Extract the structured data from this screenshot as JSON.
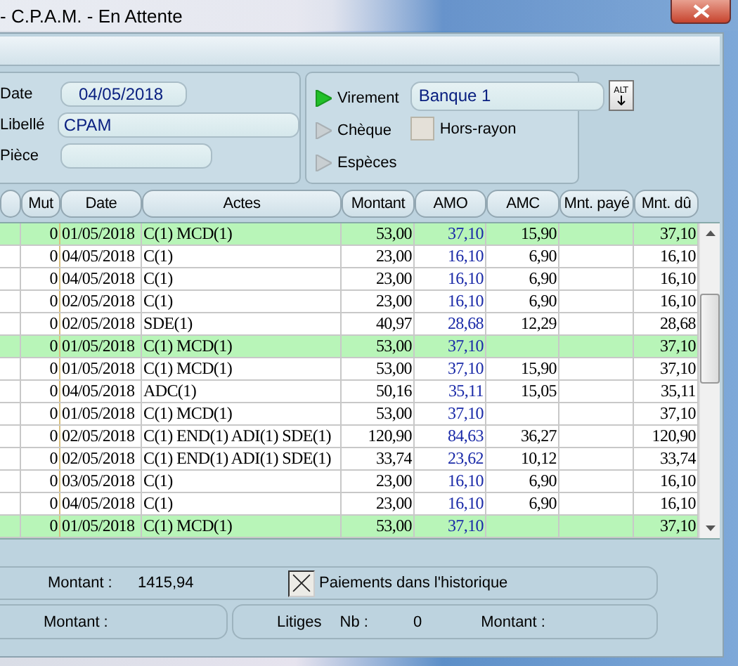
{
  "window": {
    "title": "- C.P.A.M. - En Attente"
  },
  "form": {
    "fields": [
      {
        "label": "Date",
        "value": "04/05/2018",
        "kind": "short"
      },
      {
        "label": "Libellé",
        "value": "CPAM",
        "kind": "long"
      },
      {
        "label": "Pièce",
        "kind": "medium"
      }
    ],
    "payment_modes": [
      {
        "label": "Virement",
        "selected": true
      },
      {
        "label": "Chèque",
        "selected": false
      },
      {
        "label": "Espèces",
        "selected": false
      }
    ],
    "bank": {
      "value": "Banque 1",
      "button": "ALT"
    },
    "hors_rayon": {
      "label": "Hors-rayon",
      "checked": false
    }
  },
  "table": {
    "columns": [
      "",
      "Mut",
      "Date",
      "Actes",
      "Montant",
      "AMO",
      "AMC",
      "Mnt. payé",
      "Mnt. dû"
    ],
    "rows": [
      {
        "highlighted": true,
        "cells": [
          "",
          "0",
          "01/05/2018",
          "C(1) MCD(1)",
          "53,00",
          "37,10",
          "15,90",
          "",
          "37,10"
        ]
      },
      {
        "highlighted": false,
        "cells": [
          "",
          "0",
          "04/05/2018",
          "C(1)",
          "23,00",
          "16,10",
          "6,90",
          "",
          "16,10"
        ]
      },
      {
        "highlighted": false,
        "cells": [
          "",
          "0",
          "04/05/2018",
          "C(1)",
          "23,00",
          "16,10",
          "6,90",
          "",
          "16,10"
        ]
      },
      {
        "highlighted": false,
        "cells": [
          "",
          "0",
          "02/05/2018",
          "C(1)",
          "23,00",
          "16,10",
          "6,90",
          "",
          "16,10"
        ]
      },
      {
        "highlighted": false,
        "cells": [
          "",
          "0",
          "02/05/2018",
          "SDE(1)",
          "40,97",
          "28,68",
          "12,29",
          "",
          "28,68"
        ]
      },
      {
        "highlighted": true,
        "cells": [
          "",
          "0",
          "01/05/2018",
          "C(1) MCD(1)",
          "53,00",
          "37,10",
          "",
          "",
          "37,10"
        ]
      },
      {
        "highlighted": false,
        "cells": [
          "",
          "0",
          "01/05/2018",
          "C(1) MCD(1)",
          "53,00",
          "37,10",
          "15,90",
          "",
          "37,10"
        ]
      },
      {
        "highlighted": false,
        "cells": [
          "",
          "0",
          "04/05/2018",
          "ADC(1)",
          "50,16",
          "35,11",
          "15,05",
          "",
          "35,11"
        ]
      },
      {
        "highlighted": false,
        "cells": [
          "",
          "0",
          "01/05/2018",
          "C(1) MCD(1)",
          "53,00",
          "37,10",
          "",
          "",
          "37,10"
        ]
      },
      {
        "highlighted": false,
        "cells": [
          "",
          "0",
          "02/05/2018",
          "C(1) END(1) ADI(1) SDE(1)",
          "120,90",
          "84,63",
          "36,27",
          "",
          "120,90"
        ]
      },
      {
        "highlighted": false,
        "cells": [
          "",
          "0",
          "02/05/2018",
          "C(1) END(1) ADI(1) SDE(1)",
          "33,74",
          "23,62",
          "10,12",
          "",
          "33,74"
        ]
      },
      {
        "highlighted": false,
        "cells": [
          "",
          "0",
          "03/05/2018",
          "C(1)",
          "23,00",
          "16,10",
          "6,90",
          "",
          "16,10"
        ]
      },
      {
        "highlighted": false,
        "cells": [
          "",
          "0",
          "04/05/2018",
          "C(1)",
          "23,00",
          "16,10",
          "6,90",
          "",
          "16,10"
        ]
      },
      {
        "highlighted": true,
        "cells": [
          "",
          "0",
          "01/05/2018",
          "C(1) MCD(1)",
          "53,00",
          "37,10",
          "",
          "",
          "37,10"
        ]
      }
    ]
  },
  "summary": {
    "label": "Montant :",
    "value": "1415,94",
    "history": {
      "label": "Paiements dans l'historique",
      "checked": true
    }
  },
  "footer": {
    "left_label": "Montant :",
    "litiges": "Litiges",
    "nb_label": "Nb :",
    "nb_value": "0",
    "right_label": "Montant :"
  }
}
